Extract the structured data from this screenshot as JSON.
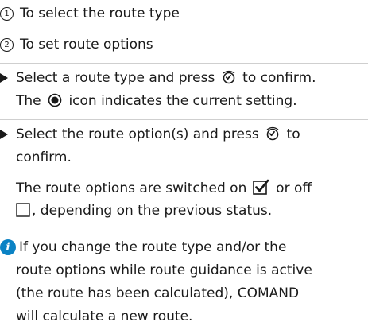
{
  "options_list": [
    {
      "number": "1",
      "text": "To select the route type"
    },
    {
      "number": "2",
      "text": "To set route options"
    }
  ],
  "step1": {
    "line1_before_icon": "Select a route type and press",
    "line1_after_icon": "to confirm.",
    "line2_before_icon": "The",
    "line2_after_icon": "icon indicates the current setting."
  },
  "step2": {
    "line1_before_icon": "Select the route option(s) and press",
    "line1_after_icon": "to",
    "line2": "confirm.",
    "line3_before_icon": "The route options are switched on",
    "line3_after_icon": "or off",
    "line4_after_icon": ", depending on the previous status."
  },
  "note": {
    "lines": [
      "If you change the route type and/or the",
      "route options while route guidance is active",
      "(the route has been calculated), COMAND",
      "will calculate a new route."
    ]
  },
  "icons": {
    "list_marker": "numbered-circle-icon",
    "bullet": "play-arrow-icon",
    "controller": "controller-press-icon",
    "radio": "radio-selected-icon",
    "checkbox_on": "checkbox-checked-icon",
    "checkbox_off": "checkbox-empty-icon",
    "info": "info-icon"
  },
  "colors": {
    "text": "#1a1a1a",
    "info_icon": "#0b82c4",
    "divider": "#cfcfcf"
  }
}
